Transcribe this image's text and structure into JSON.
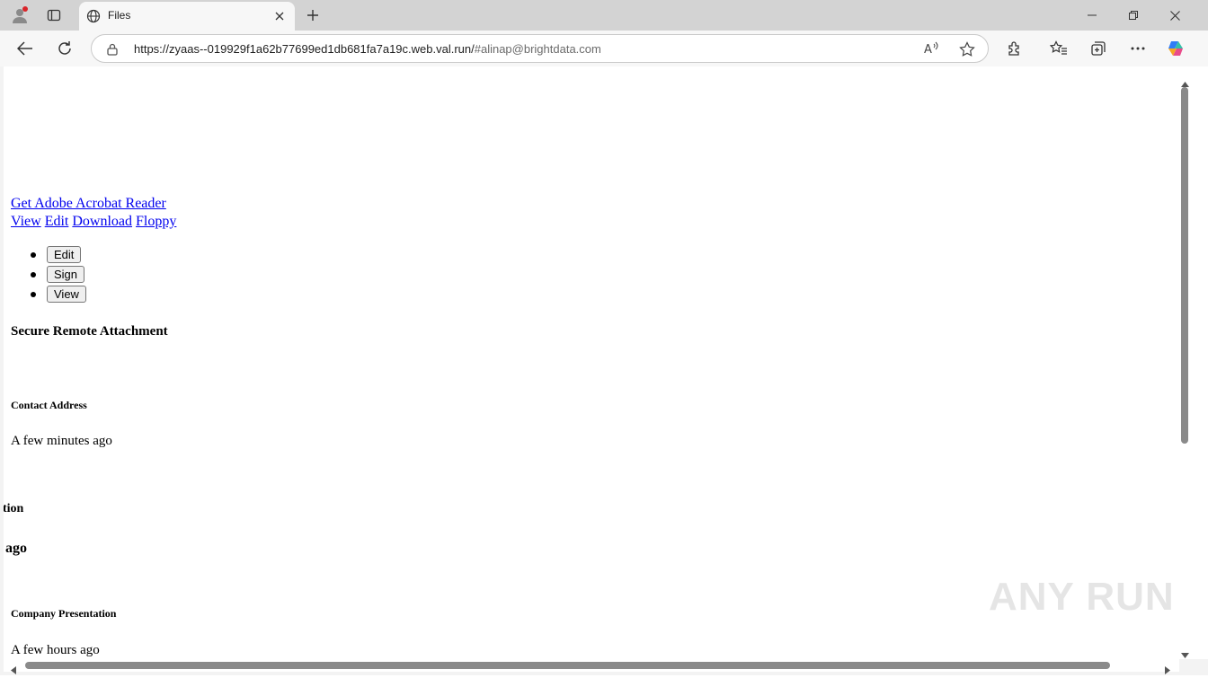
{
  "tab": {
    "title": "Files"
  },
  "address_bar": {
    "url_main": "https://zyaas--019929f1a62b77699ed1db681fa7a19c.web.val.run/",
    "url_hash": "#alinap@brightdata.com"
  },
  "page": {
    "acrobat_link": "Get Adobe Acrobat Reader",
    "links": [
      "View",
      "Edit",
      "Download",
      "Floppy"
    ],
    "buttons": [
      "Edit",
      "Sign",
      "View"
    ],
    "heading": "Secure Remote Attachment",
    "files": [
      {
        "name": "Contact Address",
        "time": "A few minutes ago"
      },
      {
        "name": "tion",
        "time": "ago"
      },
      {
        "name": "Company Presentation",
        "time": "A few hours ago"
      }
    ]
  },
  "watermark": "ANY RUN",
  "colors": {
    "link": "#0000ee",
    "tabstrip": "#d3d3d3",
    "toolbar": "#f7f7f7"
  }
}
